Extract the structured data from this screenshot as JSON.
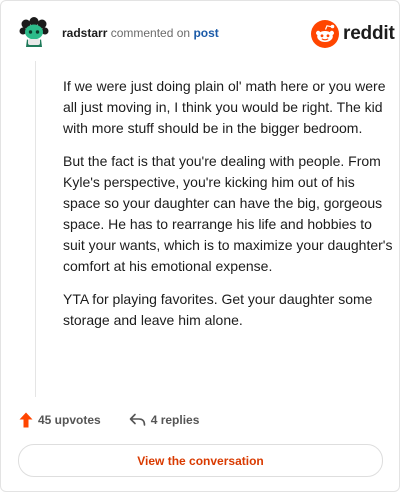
{
  "header": {
    "username": "radstarr",
    "action_text": "commented on",
    "post_link": "post",
    "logo_text": "reddit"
  },
  "comment": {
    "paragraphs": [
      "If we were just doing plain ol' math here or you were all just moving in, I think you would be right. The kid with more stuff should be in the bigger bedroom.",
      "But the fact is that you're dealing with people. From Kyle's perspective, you're kicking him out of his space so your daughter can have the big, gorgeous space. He has to rearrange his life and hobbies to suit your wants, which is to maximize your daughter's comfort at his emotional expense.",
      "YTA for playing favorites. Get your daughter some storage and leave him alone."
    ]
  },
  "actions": {
    "upvotes": "45 upvotes",
    "replies": "4 replies"
  },
  "footer": {
    "button_label": "View the conversation"
  },
  "colors": {
    "accent": "#ff4500",
    "link": "#1a5aa8",
    "button_text": "#d93a00"
  },
  "icons": {
    "avatar": "snoo-avatar-icon",
    "logo": "reddit-snoo-icon",
    "upvote": "upvote-arrow-icon",
    "reply": "reply-arrow-icon"
  }
}
